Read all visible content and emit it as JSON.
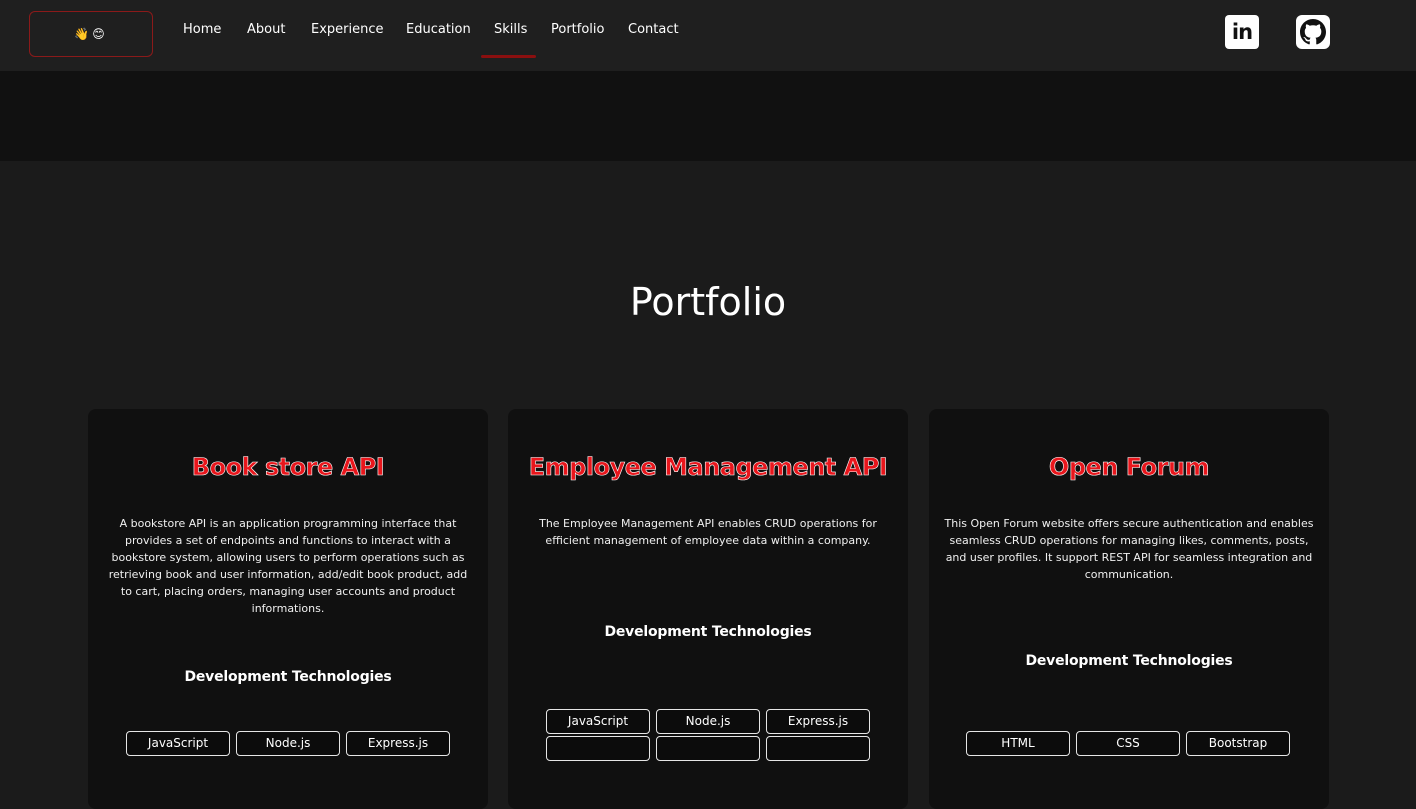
{
  "nav": {
    "logo_text": "👋😊",
    "links": [
      "Home",
      "About",
      "Experience",
      "Education",
      "Skills",
      "Portfolio",
      "Contact"
    ],
    "active": "Skills",
    "linkedin_label": "in"
  },
  "colors": {
    "accent": "#e8161c",
    "underline": "#8b0f0f",
    "card_bg": "#101010",
    "page_bg": "#1b1b1b"
  },
  "section": {
    "title": "Portfolio"
  },
  "cards": [
    {
      "title": "Book store API",
      "description": "A bookstore API is an application programming interface that provides a set of endpoints and functions to interact with a bookstore system, allowing users to perform operations such as retrieving book and user information, add/edit book product, add to cart, placing orders, managing user accounts and product informations.",
      "subtitle": "Development Technologies",
      "tags": [
        "JavaScript",
        "Node.js",
        "Express.js"
      ]
    },
    {
      "title": "Employee Management API",
      "description": "The Employee Management API enables CRUD operations for efficient management of employee data within a company.",
      "subtitle": "Development Technologies",
      "tags": [
        "JavaScript",
        "Node.js",
        "Express.js"
      ]
    },
    {
      "title": "Open Forum",
      "description": "This Open Forum website offers secure authentication and enables seamless CRUD operations for managing likes, comments, posts, and user profiles. It support REST API for seamless integration and communication.",
      "subtitle": "Development Technologies",
      "tags": [
        "HTML",
        "CSS",
        "Bootstrap"
      ]
    }
  ]
}
